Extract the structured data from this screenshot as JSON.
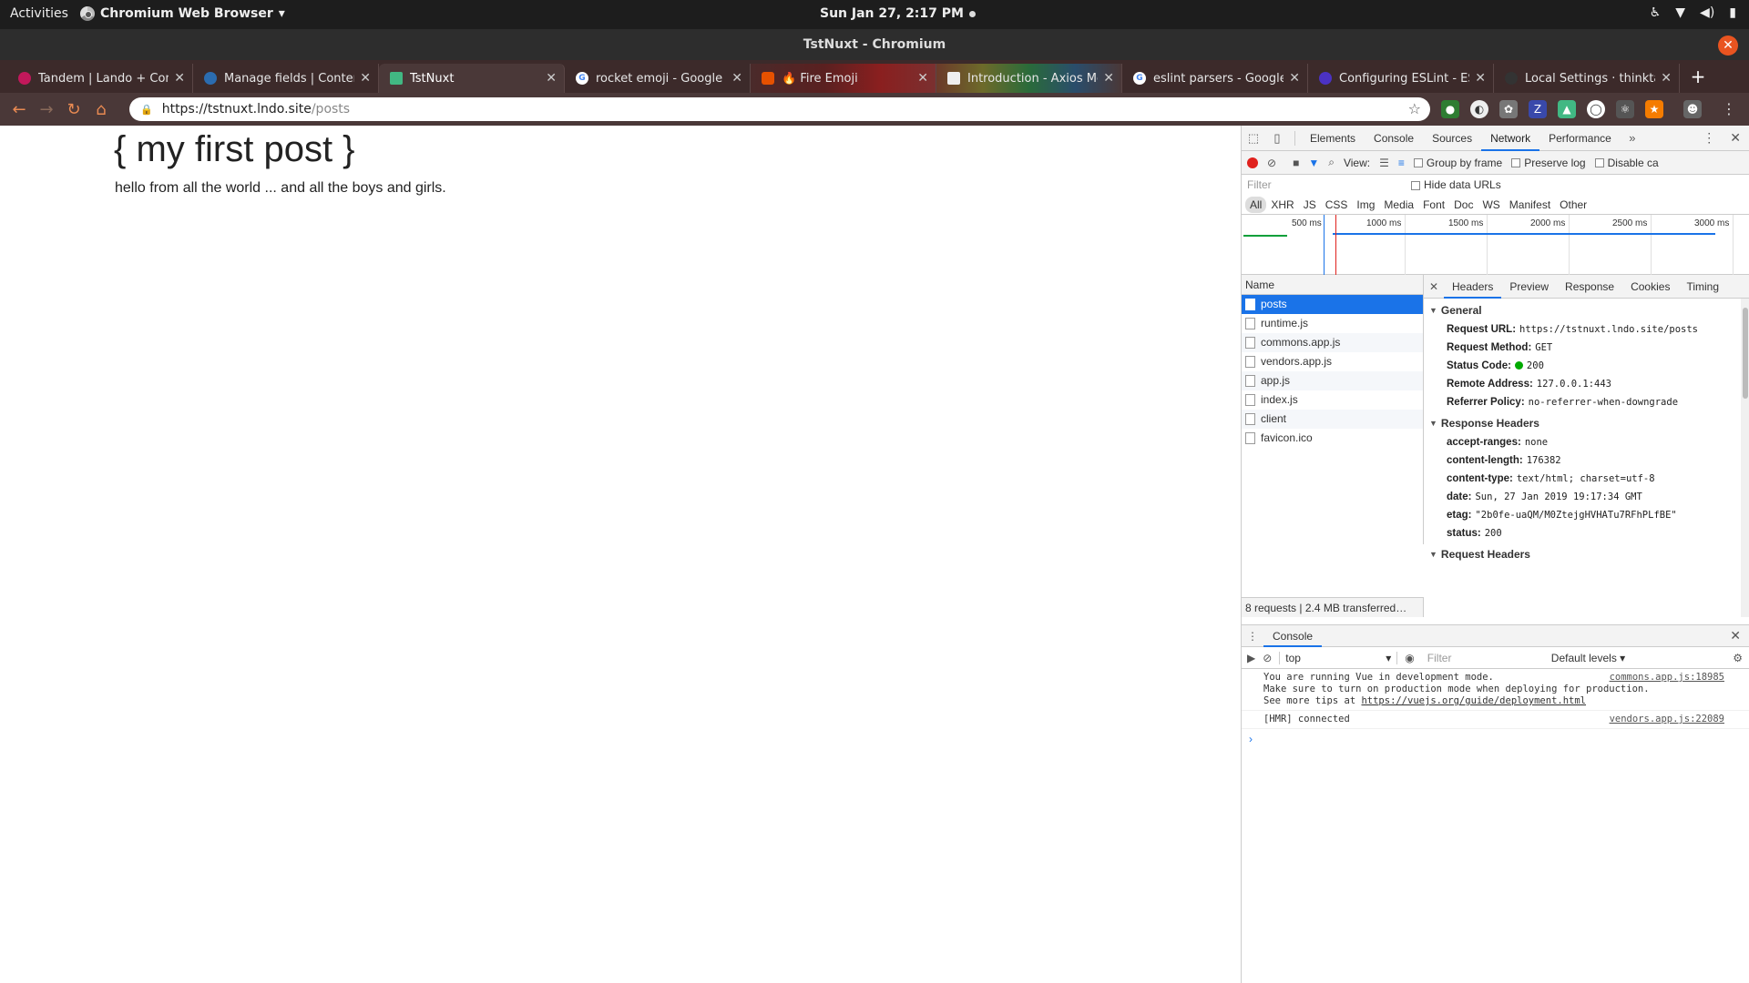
{
  "os": {
    "activities": "Activities",
    "app_name": "Chromium Web Browser",
    "clock": "Sun Jan 27,  2:17 PM"
  },
  "window": {
    "title": "TstNuxt - Chromium"
  },
  "tabs": [
    {
      "title": "Tandem | Lando + Conte",
      "favicon_color": "#c2185b"
    },
    {
      "title": "Manage fields | Content",
      "favicon_color": "#2b6cb0"
    },
    {
      "title": "TstNuxt",
      "favicon_color": "#41b883"
    },
    {
      "title": "rocket emoji - Google S",
      "favicon_color": "#4285f4"
    },
    {
      "title": "🔥 Fire Emoji",
      "favicon_color": "#e65100"
    },
    {
      "title": "Introduction - Axios Mo",
      "favicon_color": "#eeeeee"
    },
    {
      "title": "eslint parsers - Google",
      "favicon_color": "#4285f4"
    },
    {
      "title": "Configuring ESLint - ESl",
      "favicon_color": "#4b32c3"
    },
    {
      "title": "Local Settings · thinkta",
      "favicon_color": "#333333"
    }
  ],
  "address": {
    "host": "https://tstnuxt.lndo.site",
    "path": "/posts"
  },
  "page": {
    "heading": "{ my first post }",
    "body": "hello from all the world ... and all the boys and girls."
  },
  "devtools": {
    "tabs": [
      "Elements",
      "Console",
      "Sources",
      "Network",
      "Performance"
    ],
    "active_tab": "Network",
    "network_toolbar": {
      "view_label": "View:",
      "group_by_frame": "Group by frame",
      "preserve_log": "Preserve log",
      "disable_cache": "Disable ca"
    },
    "filter_placeholder": "Filter",
    "hide_data_urls": "Hide data URLs",
    "type_filters": [
      "All",
      "XHR",
      "JS",
      "CSS",
      "Img",
      "Media",
      "Font",
      "Doc",
      "WS",
      "Manifest",
      "Other"
    ],
    "timeline_ticks": [
      "500 ms",
      "1000 ms",
      "1500 ms",
      "2000 ms",
      "2500 ms",
      "3000 ms"
    ],
    "name_header": "Name",
    "requests": [
      "posts",
      "runtime.js",
      "commons.app.js",
      "vendors.app.js",
      "app.js",
      "index.js",
      "client",
      "favicon.ico"
    ],
    "selected_request": "posts",
    "footer": "8 requests  |  2.4 MB transferred…",
    "detail_tabs": [
      "Headers",
      "Preview",
      "Response",
      "Cookies",
      "Timing"
    ],
    "general": {
      "title": "General",
      "fields": [
        {
          "k": "Request URL:",
          "v": "https://tstnuxt.lndo.site/posts"
        },
        {
          "k": "Request Method:",
          "v": "GET"
        },
        {
          "k": "Status Code:",
          "v": "200"
        },
        {
          "k": "Remote Address:",
          "v": "127.0.0.1:443"
        },
        {
          "k": "Referrer Policy:",
          "v": "no-referrer-when-downgrade"
        }
      ]
    },
    "response_headers": {
      "title": "Response Headers",
      "fields": [
        {
          "k": "accept-ranges:",
          "v": "none"
        },
        {
          "k": "content-length:",
          "v": "176382"
        },
        {
          "k": "content-type:",
          "v": "text/html; charset=utf-8"
        },
        {
          "k": "date:",
          "v": "Sun, 27 Jan 2019 19:17:34 GMT"
        },
        {
          "k": "etag:",
          "v": "\"2b0fe-uaQM/M0ZtejgHVHATu7RFhPLfBE\""
        },
        {
          "k": "status:",
          "v": "200"
        }
      ]
    },
    "request_headers_title": "Request Headers",
    "console": {
      "tab": "Console",
      "context": "top",
      "filter_placeholder": "Filter",
      "levels": "Default levels ▾",
      "messages": [
        {
          "lines": [
            "You are running Vue in development mode.",
            "Make sure to turn on production mode when deploying for production.",
            "See more tips at "
          ],
          "link": "https://vuejs.org/guide/deployment.html",
          "source": "commons.app.js:18985"
        },
        {
          "lines": [
            "[HMR] connected"
          ],
          "link": "",
          "source": "vendors.app.js:22089"
        }
      ]
    }
  }
}
